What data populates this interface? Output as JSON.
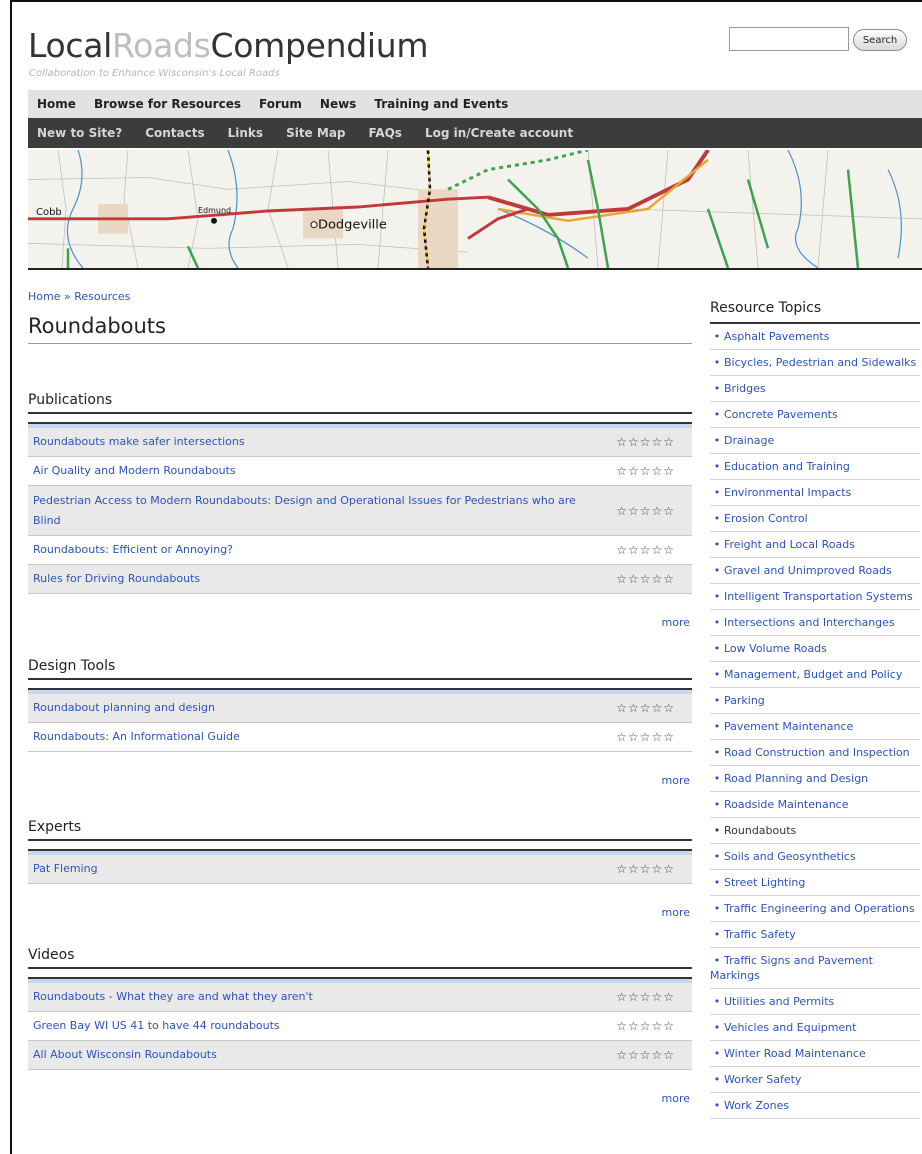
{
  "header": {
    "logo_part1": "Local",
    "logo_part2": "Roads",
    "logo_part3": "Compendium",
    "tagline": "Collaboration to Enhance Wisconsin's Local Roads",
    "search_button": "Search",
    "search_placeholder": ""
  },
  "nav_primary": [
    "Home",
    "Browse for Resources",
    "Forum",
    "News",
    "Training and Events"
  ],
  "nav_secondary": [
    "New to Site?",
    "Contacts",
    "Links",
    "Site Map",
    "FAQs",
    "Log in/Create account"
  ],
  "map_labels": {
    "cobb": "Cobb",
    "edmund": "Edmund",
    "dodgeville": "Dodgeville"
  },
  "breadcrumb": {
    "home": "Home",
    "sep": "»",
    "resources": "Resources"
  },
  "page_title": "Roundabouts",
  "stars_glyph": "☆☆☆☆☆",
  "more_label": "more",
  "sections": [
    {
      "title": "Publications",
      "items": [
        "Roundabouts make safer intersections",
        "Air Quality and Modern Roundabouts",
        "Pedestrian Access to Modern Roundabouts: Design and Operational Issues for Pedestrians who are Blind",
        "Roundabouts: Efficient or Annoying?",
        "Rules for Driving Roundabouts"
      ]
    },
    {
      "title": "Design Tools",
      "items": [
        "Roundabout planning and design",
        "Roundabouts: An Informational Guide"
      ]
    },
    {
      "title": "Experts",
      "items": [
        "Pat Fleming"
      ]
    },
    {
      "title": "Videos",
      "items": [
        "Roundabouts - What they are and what they aren't",
        "Green Bay WI US 41 to have 44 roundabouts",
        "All About Wisconsin Roundabouts"
      ]
    }
  ],
  "sidebar": {
    "title": "Resource Topics",
    "bullet": "•",
    "topics": [
      "Asphalt Pavements",
      "Bicycles, Pedestrian and Sidewalks",
      "Bridges",
      "Concrete Pavements",
      "Drainage",
      "Education and Training",
      "Environmental Impacts",
      "Erosion Control",
      "Freight and Local Roads",
      "Gravel and Unimproved Roads",
      "Intelligent Transportation Systems",
      "Intersections and Interchanges",
      "Low Volume Roads",
      "Management, Budget and Policy",
      "Parking",
      "Pavement Maintenance",
      "Road Construction and Inspection",
      "Road Planning and Design",
      "Roadside Maintenance",
      "Roundabouts",
      "Soils and Geosynthetics",
      "Street Lighting",
      "Traffic Engineering and Operations",
      "Traffic Safety",
      "Traffic Signs and Pavement Markings",
      "Utilities and Permits",
      "Vehicles and Equipment",
      "Winter Road Maintenance",
      "Worker Safety",
      "Work Zones"
    ],
    "current": "Roundabouts"
  }
}
